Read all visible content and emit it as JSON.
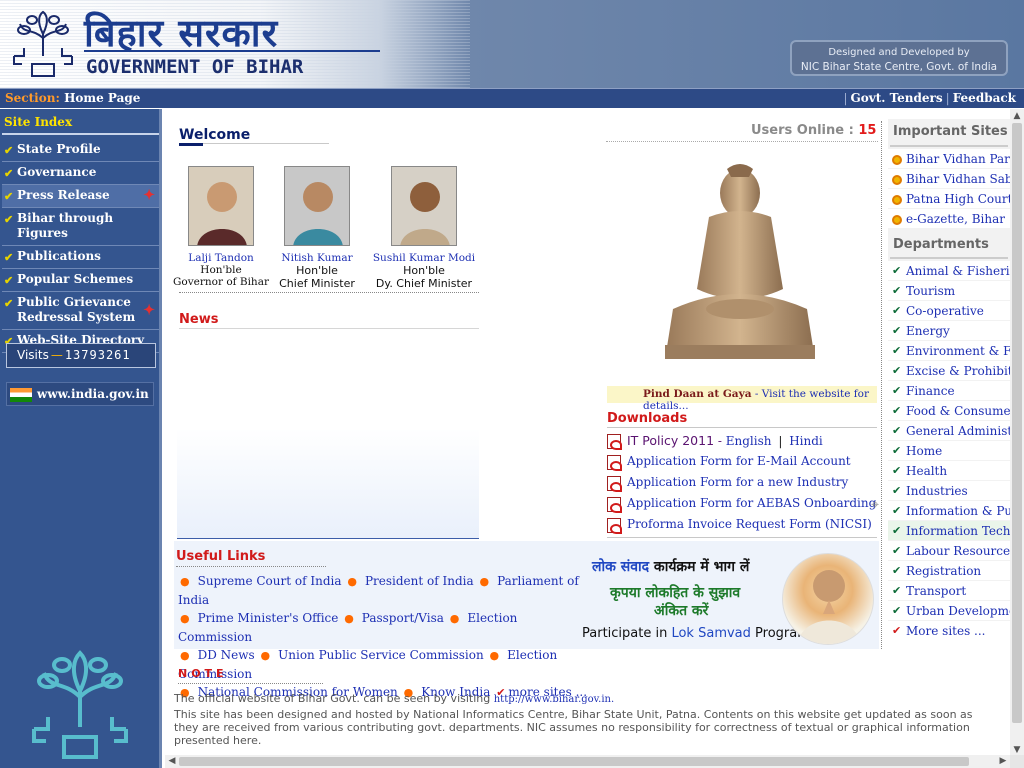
{
  "header": {
    "hindi_title": "बिहार सरकार",
    "english_title": "GOVERNMENT OF BIHAR",
    "designed_line1": "Designed and Developed by",
    "designed_line2": "NIC Bihar State Centre, Govt. of India"
  },
  "section_bar": {
    "section_key": "Section:",
    "section_value": "Home Page",
    "links": [
      "Govt. Tenders",
      "Feedback"
    ]
  },
  "sidebar": {
    "site_index": "Site Index",
    "items": [
      {
        "label": "State Profile"
      },
      {
        "label": "Governance"
      },
      {
        "label": "Press Release"
      },
      {
        "label": "Bihar through Figures"
      },
      {
        "label": "Publications"
      },
      {
        "label": "Popular Schemes"
      },
      {
        "label": "Public Grievance Redressal System"
      },
      {
        "label": "Web-Site Directory"
      }
    ],
    "visits_label": "Visits",
    "visits_count": "13793261",
    "india_link": "www.india.gov.in"
  },
  "welcome": {
    "title": "Welcome",
    "people": [
      {
        "name": "Lalji Tandon",
        "hon": "Hon'ble",
        "role": "Governor of Bihar"
      },
      {
        "name": "Nitish Kumar",
        "hon": "Hon'ble",
        "role": "Chief Minister"
      },
      {
        "name": "Sushil Kumar Modi",
        "hon": "Hon'ble",
        "role": "Dy. Chief Minister"
      }
    ]
  },
  "news": {
    "title": "News"
  },
  "users_online": {
    "label": "Users Online :",
    "count": "15"
  },
  "pind_daan": {
    "bold": "Pind Daan at Gaya",
    "rest": " - Visit the website for details..."
  },
  "downloads": {
    "title": "Downloads",
    "it_policy": {
      "label": "IT Policy 2011",
      "dash": "-",
      "english": "English",
      "sep": "|",
      "hindi": "Hindi"
    },
    "items": [
      "Application Form for E-Mail Account",
      "Application Form for a new Industry",
      "Application Form for AEBAS Onboarding",
      "Proforma Invoice Request Form (NICSI)"
    ]
  },
  "important_sites": {
    "title": "Important Sites",
    "items": [
      "Bihar Vidhan Parishad",
      "Bihar Vidhan Sabha",
      "Patna High Court",
      "e-Gazette, Bihar"
    ]
  },
  "departments": {
    "title": "Departments",
    "items": [
      "Animal & Fisheries",
      "Tourism",
      "Co-operative",
      "Energy",
      "Environment & Forest",
      "Excise & Prohibition",
      "Finance",
      "Food & Consumer Protection",
      "General Administration",
      "Home",
      "Health",
      "Industries",
      "Information & Public Relations",
      "Information Technology",
      "Labour Resources",
      "Registration",
      "Transport",
      "Urban Development",
      "More sites ..."
    ]
  },
  "useful_links": {
    "title": "Useful Links",
    "rows": [
      [
        "Supreme Court of India",
        "President of India",
        "Parliament of India"
      ],
      [
        "Prime Minister's Office",
        "Passport/Visa",
        "Election Commission"
      ],
      [
        "DD News",
        "Union Public Service Commission",
        "Election Commission"
      ],
      [
        "National Commission for Women",
        "Know India"
      ]
    ],
    "more": "more sites ..."
  },
  "lok_samvad": {
    "l1_a": "लोक संवाद",
    "l1_b": " कार्यक्रम में भाग लें",
    "l2": "कृपया लोकहित के सुझाव",
    "l3": "अंकित करें",
    "l4_a": "Participate in ",
    "l4_b": "Lok Samvad",
    "l4_c": " Programme"
  },
  "note": {
    "title": "NOTE",
    "line1": "The official website of Bihar Govt. can be seen by visiting",
    "url": "http://www.bihar.gov.in.",
    "line2": "This site has been designed and hosted by National Informatics Centre, Bihar State Unit, Patna. Contents on this website get updated as soon as they are received from various contributing govt. departments. NIC assumes no responsibility for correctness of textual or graphical information presented here."
  },
  "colors": {
    "sidebar": "#34558f",
    "accent_red": "#d11a1a",
    "link_blue": "#1d2fb3"
  }
}
